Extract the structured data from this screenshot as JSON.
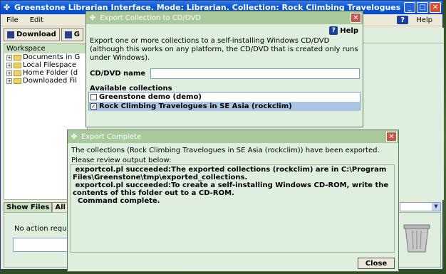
{
  "main_window": {
    "title": "Greenstone Librarian Interface. Mode: Librarian. Collection: Rock Climbing Travelogues in SE Asia (rockclim)",
    "menu": {
      "file": "File",
      "edit": "Edit",
      "help": "Help"
    },
    "toolbar": {
      "download": "Download",
      "gather": "G"
    },
    "workspace": {
      "header": "Workspace",
      "items": [
        {
          "label": "Documents in G"
        },
        {
          "label": "Local Filespace"
        },
        {
          "label": "Home Folder (d"
        },
        {
          "label": "Downloaded Fil"
        }
      ]
    },
    "tabs": {
      "show_files": "Show Files",
      "all_files": "All F"
    },
    "status": "No action requ"
  },
  "export_dialog": {
    "title": "Export Collection to CD/DVD",
    "help": "Help",
    "description": "Export one or more collections to a self-installing Windows CD/DVD (although this works on any platform, the CD/DVD that is created only runs under Windows).",
    "cd_name_label": "CD/DVD name",
    "cd_name_value": "",
    "available_label": "Available collections",
    "collections": [
      {
        "label": "Greenstone demo (demo)",
        "checked": false
      },
      {
        "label": "Rock Climbing Travelogues in SE Asia (rockclim)",
        "checked": true
      }
    ]
  },
  "complete_dialog": {
    "title": "Export Complete",
    "message": "The collections (Rock Climbing Travelogues in SE Asia (rockclim)) have been exported.",
    "review_label": "Please review output below:",
    "output": " exportcol.pl succeeded:The exported collections (rockclim) are in C:\\Program Files\\Greenstone\\tmp\\exported_collections.\n exportcol.pl succeeded:To create a self-installing Windows CD-ROM, write the contents of this folder out to a CD-ROM.\n  Command complete.",
    "close_label": "Close"
  }
}
